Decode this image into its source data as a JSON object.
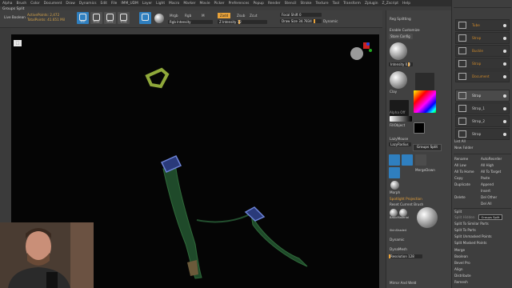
{
  "menu": [
    "Alpha",
    "Brush",
    "Color",
    "Document",
    "Draw",
    "Dynamics",
    "Edit",
    "File",
    "IMM_UDM",
    "Layer",
    "Light",
    "Macro",
    "Marker",
    "Movie",
    "Picker",
    "Preferences",
    "Popup",
    "Render",
    "Stencil",
    "Stroke",
    "Texture",
    "Tool",
    "Transform",
    "Zplugin",
    "Z_Zscript",
    "Help"
  ],
  "subtitle": "Groups Split",
  "toolbar": {
    "lightbox": "Live Boolean",
    "active_points": "ActivePoints: 2,472",
    "total_points": "TotalPoints: 41.651 Mil",
    "edit": "Edit",
    "draw": "Draw",
    "move": "Move",
    "scale": "Scale",
    "rotate": "Rotate",
    "mrgb": "Mrgb",
    "rgb": "Rgb",
    "m": "M",
    "rgb_intensity": "Rgb Intensity",
    "zadd": "Zadd",
    "zsub": "Zsub",
    "zcut": "Zcut",
    "z_intensity": "Z Intensity 12",
    "focal_shift": "Focal Shift 0",
    "draw_size": "Draw Size 34.7834",
    "divide": "Divide",
    "dynamic": "Dynamic",
    "reg_splitting": "Reg Splitting"
  },
  "panel1": {
    "enable_customize": "Enable Customize",
    "store_config": "Store Config",
    "intensity": "Intensity 0.8",
    "alpha_off": "Alpha Off",
    "clay": "Clay",
    "fill_object": "FillObject",
    "lazymouse": "LazyMouse",
    "lazy_radius": "LazyRadius",
    "groups_split": "Groups Split",
    "merge_down": "MergeDown",
    "morph": "Morph",
    "spotlight": "Spotlight Projection",
    "reset_brush": "Reset Current Brush",
    "basic_material": "BasicMaterial",
    "skin_shade": "SkinShade4",
    "dynamic": "Dynamic",
    "dynamesh": "DynaMesh",
    "resolution": "Resolution 128",
    "mirror_weld": "Mirror And Weld"
  },
  "panel2": {
    "subtools": [
      "Tube",
      "Strap",
      "Strap",
      "Buckle",
      "Strap",
      "Document",
      "Strap",
      "Strap_1",
      "Strap_2",
      "Strap"
    ],
    "list_all": "List All",
    "new_folder": "New Folder",
    "rows": [
      [
        "Rename",
        "AutoReorder"
      ],
      [
        "All Low",
        "All High"
      ],
      [
        "All To Home",
        "All To Target"
      ],
      [
        "Copy",
        "Paste"
      ],
      [
        "Duplicate",
        "Append"
      ],
      [
        "",
        "Insert"
      ],
      [
        "Delete",
        "Del Other"
      ],
      [
        "",
        "Del All"
      ]
    ],
    "split_label": "Split",
    "split_hidden": "Split Hidden",
    "groups_split": "Groups Split",
    "split_similar": "Split To Similar Parts",
    "split_parts": "Split To Parts",
    "split_unmasked": "Split Unmasked Points",
    "split_masked": "Split Masked Points",
    "others": [
      "Merge",
      "Boolean",
      "Bevel Pro",
      "Align",
      "Distribute",
      "Remesh",
      "Project"
    ]
  }
}
